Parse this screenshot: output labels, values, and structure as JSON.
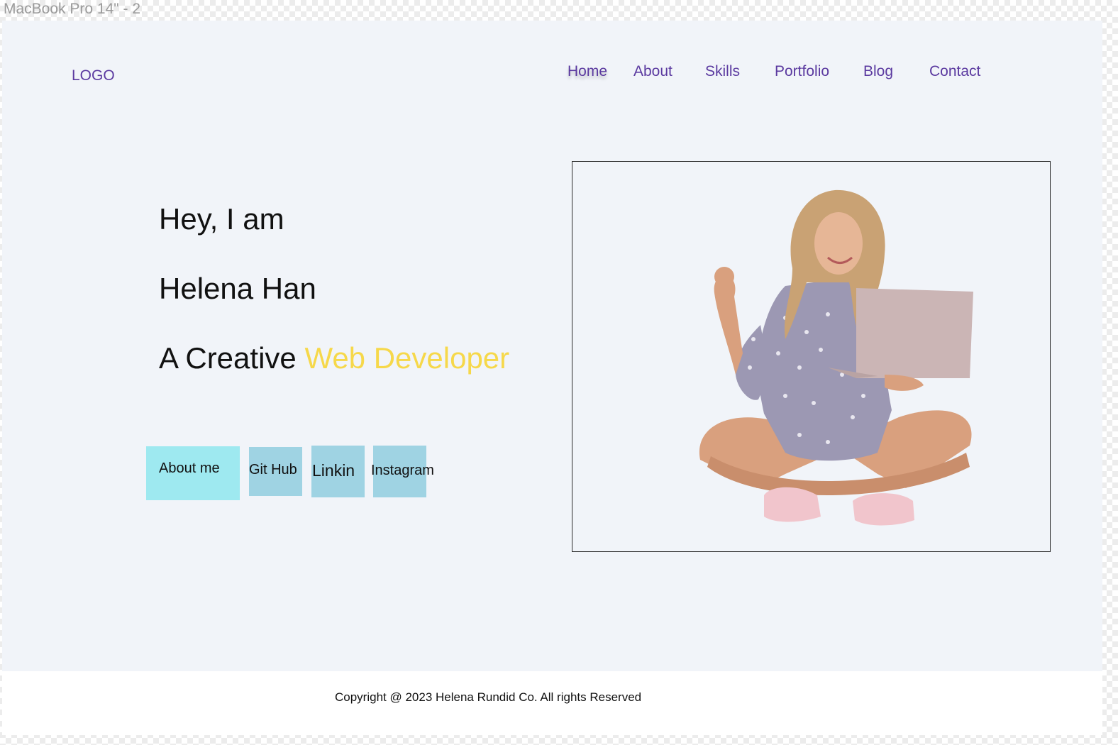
{
  "frame": {
    "label": "MacBook Pro 14\" - 2"
  },
  "header": {
    "logo": "LOGO",
    "nav": [
      "Home",
      "About",
      "Skills",
      "Portfolio",
      "Blog",
      "Contact"
    ]
  },
  "hero": {
    "greeting": "Hey, I am",
    "name": "Helena Han",
    "tagline_prefix": "A Creative ",
    "tagline_highlight": "Web Developer"
  },
  "buttons": {
    "about_me": "About me",
    "github": "Git Hub",
    "linkedin": "Linkin",
    "instagram": "Instagram"
  },
  "footer": {
    "copyright": "Copyright @ 2023 Helena Rundid Co. All rights Reserved"
  },
  "colors": {
    "accent": "#f6d84a",
    "nav": "#5b3aa0",
    "primary_button": "#9ee9f0",
    "secondary_button": "#9fd3e3",
    "background": "#f1f4f9"
  },
  "icons": {
    "hero_image": "woman-with-laptop-photo"
  }
}
